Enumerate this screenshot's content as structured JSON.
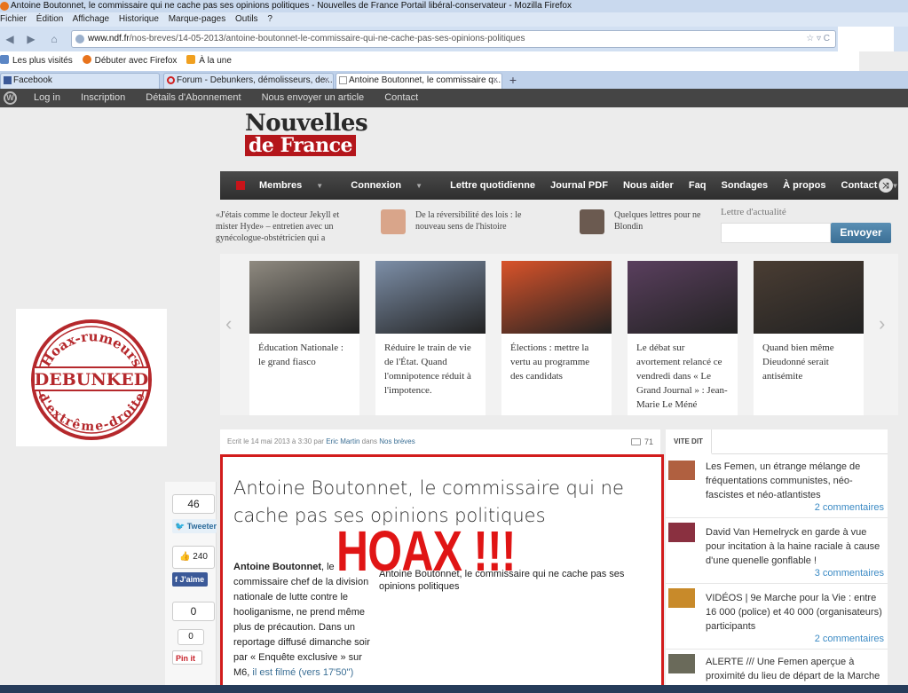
{
  "browser": {
    "title": "Antoine Boutonnet, le commissaire qui ne cache pas ses opinions politiques - Nouvelles de France Portail libéral-conservateur - Mozilla Firefox",
    "menu": [
      "Fichier",
      "Édition",
      "Affichage",
      "Historique",
      "Marque-pages",
      "Outils",
      "?"
    ],
    "url_host": "www.ndf.fr",
    "url_path": "/nos-breves/14-05-2013/antoine-boutonnet-le-commissaire-qui-ne-cache-pas-ses-opinions-politiques",
    "bookmarks": [
      "Les plus visités",
      "Débuter avec Firefox",
      "À la une"
    ],
    "tabs": [
      {
        "label": "Facebook"
      },
      {
        "label": "Forum - Debunkers, démolisseurs, de..."
      },
      {
        "label": "Antoine Boutonnet, le commissaire q..."
      }
    ],
    "new_tab": "+",
    "close_glyph": "×"
  },
  "admin_bar": {
    "logo": "W",
    "links": [
      "Log in",
      "Inscription",
      "Détails d'Abonnement",
      "Nous envoyer un article",
      "Contact"
    ]
  },
  "site": {
    "logo_top": "Nouvelles",
    "logo_bottom": "de France"
  },
  "main_nav": {
    "items": [
      "Membres",
      "Connexion",
      "Lettre quotidienne",
      "Journal PDF",
      "Nous aider",
      "Faq",
      "Sondages",
      "À propos",
      "Contact"
    ],
    "caret": "▼",
    "shuffle": "⤨"
  },
  "ticker": [
    {
      "text": "«J'étais comme le docteur Jekyll et mister Hyde» – entretien avec un gynécologue-obstétricien qui a"
    },
    {
      "text": "De la réversibilité des lois : le nouveau sens de l'histoire"
    },
    {
      "text": "Quelques lettres pour ne Blondin"
    }
  ],
  "newsletter": {
    "label": "Lettre d'actualité",
    "button": "Envoyer"
  },
  "carousel": {
    "prev": "‹",
    "next": "›",
    "cards": [
      {
        "caption": "Éducation Nationale : le grand fiasco",
        "color": "#8f8a80"
      },
      {
        "caption": "Réduire le train de vie de l'État. Quand l'omnipotence réduit à l'impotence.",
        "color": "#7d8fa8"
      },
      {
        "caption": "Élections : mettre la vertu au programme des candidats",
        "color": "#d9532a"
      },
      {
        "caption": "Le débat sur avortement relancé ce vendredi dans « Le Grand Journal » : Jean-Marie Le Méné",
        "color": "#5a3f5e"
      },
      {
        "caption": "Quand bien même Dieudonné serait antisémite",
        "color": "#4a3d33"
      }
    ]
  },
  "stamp": {
    "top": "Hoax-rumeurs",
    "middle": "DEBUNKED",
    "bottom": "d'extrême-droite"
  },
  "article": {
    "meta_prefix": "Ecrit le 14 mai 2013 à 3:30 par",
    "author": "Eric Martin",
    "meta_in": "dans",
    "category": "Nos brèves",
    "comments": "71",
    "title": "Antoine Boutonnet, le commissaire qui ne cache pas ses opinions politiques",
    "lead_name": "Antoine Boutonnet",
    "lead_rest": ", le commissaire chef de la division nationale de lutte contre le hooliganisme, ne prend même plus de précaution. Dans un reportage diffusé dimanche soir par « Enquête exclusive » sur M6, ",
    "lead_link": "il est filmé (vers 17'50'')",
    "caption": "Antoine Boutonnet, le commissaire qui ne cache pas ses opinions politiques",
    "hoax": "HOAX !!!"
  },
  "share": {
    "count1": "46",
    "tweet": "Tweeter",
    "likes": "240",
    "jaime": "J'aime",
    "count2": "0",
    "count3": "0",
    "pin": "Pin it"
  },
  "sidebar": {
    "tab": "VITE DIT",
    "items": [
      {
        "text": "Les Femen, un étrange mélange de fréquentations communistes, néo-fascistes et néo-atlantistes",
        "comments": "2 commentaires",
        "color": "#b06040"
      },
      {
        "text": "David Van Hemelryck en garde à vue pour incitation à la haine raciale à cause d'une quenelle gonflable !",
        "comments": "3 commentaires",
        "color": "#8a3040"
      },
      {
        "text": "VIDÉOS | 9e Marche pour la Vie : entre 16 000 (police) et 40 000 (organisateurs) participants",
        "comments": "2 commentaires",
        "color": "#c88a2a"
      },
      {
        "text": "ALERTE /// Une Femen aperçue à proximité du lieu de départ de la Marche",
        "comments": "",
        "color": "#6a6a5a"
      }
    ]
  }
}
